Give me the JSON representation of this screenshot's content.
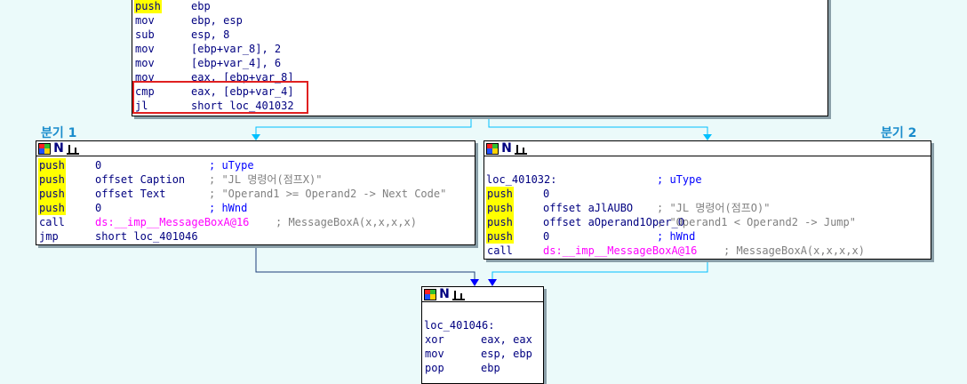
{
  "colors": {
    "background": "#ebfafa",
    "instruction": "#000080",
    "mnemonic_highlight": "#ffff00",
    "comment": "#808080",
    "variable": "#008000",
    "import": "#ff00ff",
    "edge_cyan": "#00c0ff",
    "edge_blue": "#0000ff",
    "edge_dark": "#1c3f7a",
    "highlight_box": "#e02020",
    "branch_label": "#1a8ccc"
  },
  "icons": [
    "graph-color-icon",
    "name-n-icon",
    "xref-bars-icon"
  ],
  "labels": {
    "branch1": "분기 1",
    "branch2": "분기 2"
  },
  "top_block": {
    "lines": [
      {
        "mn": "push",
        "hl": true,
        "ops": "ebp"
      },
      {
        "mn": "mov",
        "hl": false,
        "ops": "ebp, esp"
      },
      {
        "mn": "sub",
        "hl": false,
        "ops": "esp, 8"
      },
      {
        "mn": "mov",
        "hl": false,
        "ops": "[ebp+var_8], 2"
      },
      {
        "mn": "mov",
        "hl": false,
        "ops": "[ebp+var_4], 6"
      },
      {
        "mn": "mov",
        "hl": false,
        "ops": "eax, [ebp+var_8]"
      },
      {
        "mn": "cmp",
        "hl": false,
        "ops": "eax, [ebp+var_4]"
      },
      {
        "mn": "jl",
        "hl": false,
        "ops": "short loc_401032"
      }
    ]
  },
  "left_block": {
    "lines": [
      {
        "mn": "push",
        "hl": true,
        "ops": "0",
        "comment": "; uType"
      },
      {
        "mn": "push",
        "hl": true,
        "ops": "offset Caption",
        "comment": "; \"JL 명령어(점프X)\""
      },
      {
        "mn": "push",
        "hl": true,
        "ops": "offset Text",
        "comment": "; \"Operand1 >= Operand2 -> Next Code\""
      },
      {
        "mn": "push",
        "hl": true,
        "ops": "0",
        "comment": "; hWnd"
      },
      {
        "mn": "call",
        "hl": false,
        "ops": "ds:__imp__MessageBoxA@16",
        "comment": "; MessageBoxA(x,x,x,x)"
      },
      {
        "mn": "jmp",
        "hl": false,
        "ops": "short loc_401046",
        "comment": ""
      }
    ]
  },
  "right_block": {
    "label": "loc_401032:",
    "label_comment": "; uType",
    "lines": [
      {
        "mn": "push",
        "hl": true,
        "ops": "0",
        "comment": ""
      },
      {
        "mn": "push",
        "hl": true,
        "ops": "offset aJlAUBO",
        "comment": "; \"JL 명령어(점프O)\""
      },
      {
        "mn": "push",
        "hl": true,
        "ops": "offset aOperand1Oper_0",
        "comment": "; \"Operand1 < Operand2 -> Jump\""
      },
      {
        "mn": "push",
        "hl": true,
        "ops": "0",
        "comment": "; hWnd"
      },
      {
        "mn": "call",
        "hl": false,
        "ops": "ds:__imp__MessageBoxA@16",
        "comment": "; MessageBoxA(x,x,x,x)"
      }
    ]
  },
  "bottom_block": {
    "label": "loc_401046:",
    "lines": [
      {
        "mn": "xor",
        "hl": false,
        "ops": "eax, eax"
      },
      {
        "mn": "mov",
        "hl": false,
        "ops": "esp, ebp"
      },
      {
        "mn": "pop",
        "hl": false,
        "ops": "ebp"
      }
    ]
  }
}
